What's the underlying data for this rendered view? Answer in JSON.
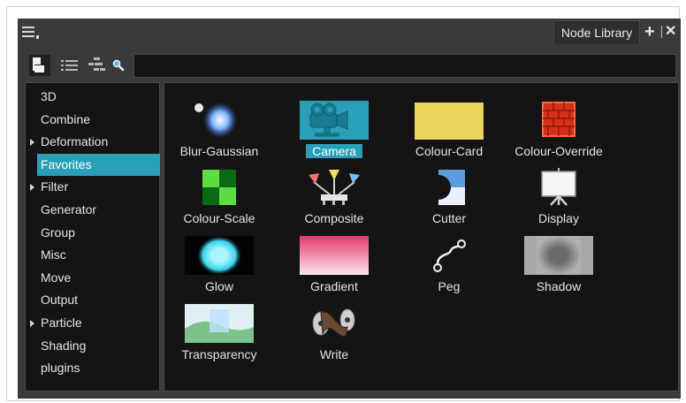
{
  "window": {
    "tab_label": "Node Library",
    "add_tab_symbol": "+",
    "close_symbol": "✕"
  },
  "toolbar": {
    "buttons": [
      "tree-view-icon",
      "list-view-icon",
      "group-view-icon",
      "search-icon"
    ],
    "search_value": ""
  },
  "sidebar": {
    "selected": "Favorites",
    "items": [
      {
        "label": "3D",
        "expandable": false
      },
      {
        "label": "Combine",
        "expandable": false
      },
      {
        "label": "Deformation",
        "expandable": true
      },
      {
        "label": "Favorites",
        "expandable": false
      },
      {
        "label": "Filter",
        "expandable": true
      },
      {
        "label": "Generator",
        "expandable": false
      },
      {
        "label": "Group",
        "expandable": false
      },
      {
        "label": "Misc",
        "expandable": false
      },
      {
        "label": "Move",
        "expandable": false
      },
      {
        "label": "Output",
        "expandable": false
      },
      {
        "label": "Particle",
        "expandable": true
      },
      {
        "label": "Shading",
        "expandable": false
      },
      {
        "label": "plugins",
        "expandable": false
      }
    ]
  },
  "nodes": {
    "selected": "Camera",
    "items": [
      {
        "label": "Blur-Gaussian",
        "icon": "blur-gaussian-icon"
      },
      {
        "label": "Camera",
        "icon": "camera-icon"
      },
      {
        "label": "Colour-Card",
        "icon": "colour-card-icon"
      },
      {
        "label": "Colour-Override",
        "icon": "colour-override-icon"
      },
      {
        "label": "Colour-Scale",
        "icon": "colour-scale-icon"
      },
      {
        "label": "Composite",
        "icon": "composite-icon"
      },
      {
        "label": "Cutter",
        "icon": "cutter-icon"
      },
      {
        "label": "Display",
        "icon": "display-icon"
      },
      {
        "label": "Glow",
        "icon": "glow-icon"
      },
      {
        "label": "Gradient",
        "icon": "gradient-icon"
      },
      {
        "label": "Peg",
        "icon": "peg-icon"
      },
      {
        "label": "Shadow",
        "icon": "shadow-icon"
      },
      {
        "label": "Transparency",
        "icon": "transparency-icon"
      },
      {
        "label": "Write",
        "icon": "write-icon"
      }
    ]
  },
  "colors": {
    "panel_bg": "#3a3a3a",
    "content_bg": "#141414",
    "selection": "#2aa0b8",
    "text": "#e3e3e3"
  }
}
